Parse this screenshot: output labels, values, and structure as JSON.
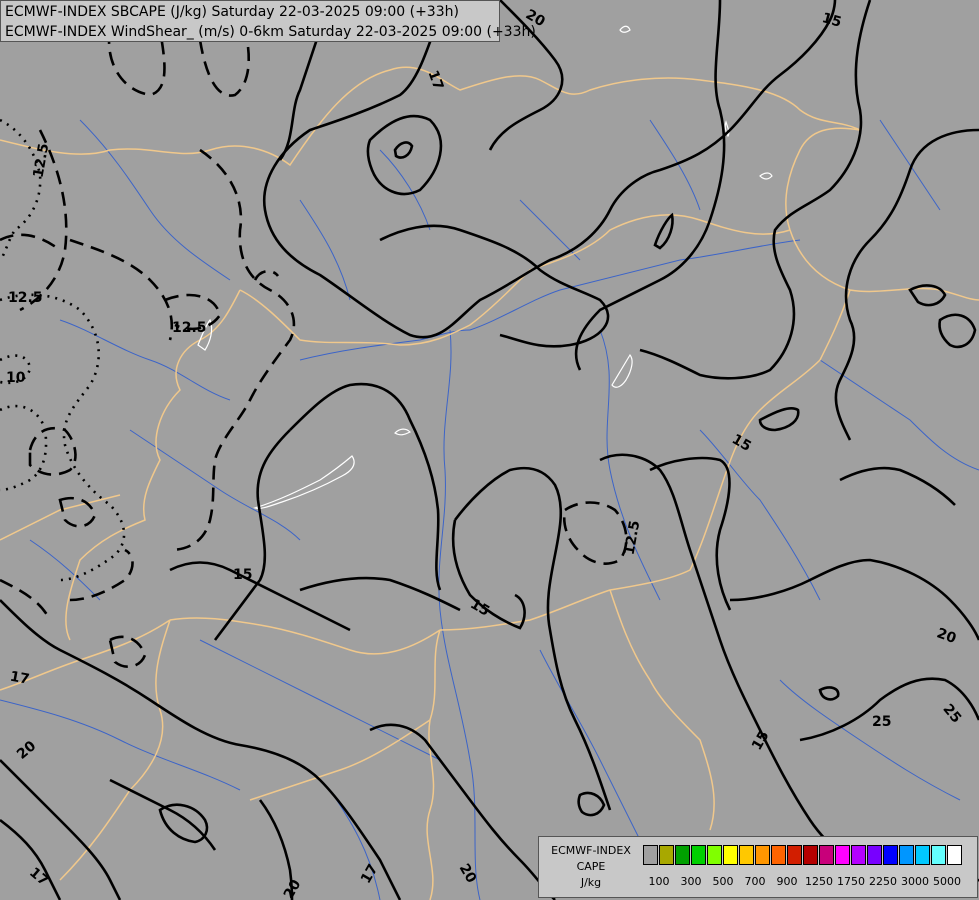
{
  "header": {
    "line1": "ECMWF-INDEX SBCAPE (J/kg) Saturday 22-03-2025 09:00 (+33h)",
    "line2": "ECMWF-INDEX WindShear_ (m/s) 0-6km Saturday 22-03-2025 09:00 (+33h)"
  },
  "legend": {
    "title_line1": "ECMWF-INDEX",
    "title_line2": "CAPE",
    "title_line3": "J/kg",
    "colors": [
      "#a0a0a0",
      "#a8a800",
      "#00a000",
      "#00d000",
      "#80ff00",
      "#ffff00",
      "#ffc800",
      "#ff9600",
      "#ff6400",
      "#d21e00",
      "#b40000",
      "#c8007a",
      "#ff00ff",
      "#b400ff",
      "#7800ff",
      "#0000ff",
      "#0096ff",
      "#00c8ff",
      "#64ffff",
      "#ffffff"
    ],
    "ticks": [
      "100",
      "300",
      "500",
      "700",
      "900",
      "1250",
      "1750",
      "2250",
      "3000",
      "5000"
    ]
  },
  "contour_labels": [
    "20",
    "15",
    "17",
    "12.5",
    "12.5",
    "12.5",
    "10",
    "15",
    "15",
    "15",
    "15",
    "12.5",
    "20",
    "25",
    "25",
    "17",
    "20",
    "17",
    "20",
    "20",
    "17"
  ],
  "colors": {
    "background": "#a0a0a0",
    "borders": "#f0c88c",
    "rivers": "#3c64c8",
    "contours": "#000000",
    "lakes": "#ffffff"
  }
}
